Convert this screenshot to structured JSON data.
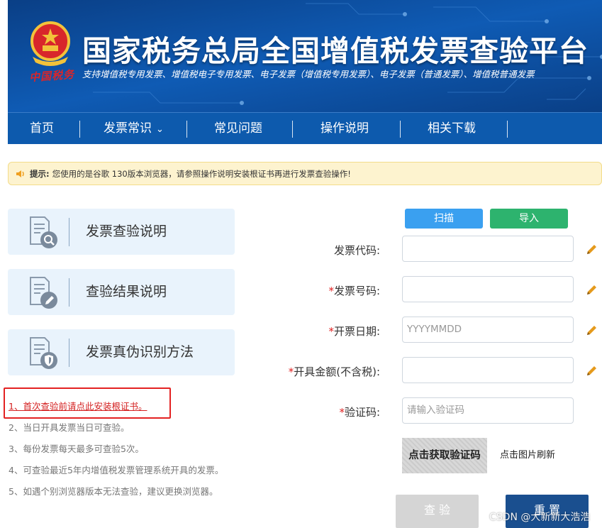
{
  "header": {
    "title": "国家税务总局全国增值税发票查验平台",
    "subtitle": "支持增值税专用发票、增值税电子专用发票、电子发票（增值税专用发票）、电子发票（普通发票）、增值税普通发票",
    "stamp": "中国税务"
  },
  "nav": {
    "items": [
      {
        "label": "首页"
      },
      {
        "label": "发票常识",
        "has_dropdown": true
      },
      {
        "label": "常见问题"
      },
      {
        "label": "操作说明"
      },
      {
        "label": "相关下载"
      }
    ]
  },
  "tip": {
    "label": "提示:",
    "text": "您使用的是谷歌 130版本浏览器，请参照操作说明安装根证书再进行发票查验操作!"
  },
  "cards": [
    {
      "label": "发票查验说明",
      "icon": "magnifier-icon"
    },
    {
      "label": "查验结果说明",
      "icon": "pencil-icon"
    },
    {
      "label": "发票真伪识别方法",
      "icon": "shield-icon"
    }
  ],
  "notes": [
    "1、首次查验前请点此安装根证书。",
    "2、当日开具发票当日可查验。",
    "3、每份发票每天最多可查验5次。",
    "4、可查验最近5年内增值税发票管理系统开具的发票。",
    "5、如遇个别浏览器版本无法查验，建议更换浏览器。"
  ],
  "form": {
    "scan_label": "扫描",
    "import_label": "导入",
    "fields": [
      {
        "label": "发票代码:",
        "required": false,
        "value": "",
        "placeholder": ""
      },
      {
        "label": "发票号码:",
        "required": true,
        "value": "",
        "placeholder": ""
      },
      {
        "label": "开票日期:",
        "required": true,
        "value": "",
        "placeholder": "YYYYMMDD"
      },
      {
        "label": "开具金额(不含税):",
        "required": true,
        "value": "",
        "placeholder": ""
      },
      {
        "label": "验证码:",
        "required": true,
        "value": "",
        "placeholder": "请输入验证码"
      }
    ],
    "required_mark": "*",
    "captcha_text": "点击获取验证码",
    "refresh_label": "点击图片刷新",
    "query_label": "查 验",
    "reset_label": "重 置"
  },
  "watermark": "CSDN @大新新大浩浩",
  "colors": {
    "header_bg": "#0b4c9a",
    "nav_bg": "#0d5aad",
    "tip_bg": "#fdf3cf",
    "card_bg": "#e9f3fc",
    "scan_btn": "#3aa0f0",
    "import_btn": "#2db36e",
    "reset_btn": "#1a4f8f",
    "query_btn_disabled": "#d5d5d5",
    "required_red": "#e02020",
    "pencil_orange": "#e59a1c"
  }
}
